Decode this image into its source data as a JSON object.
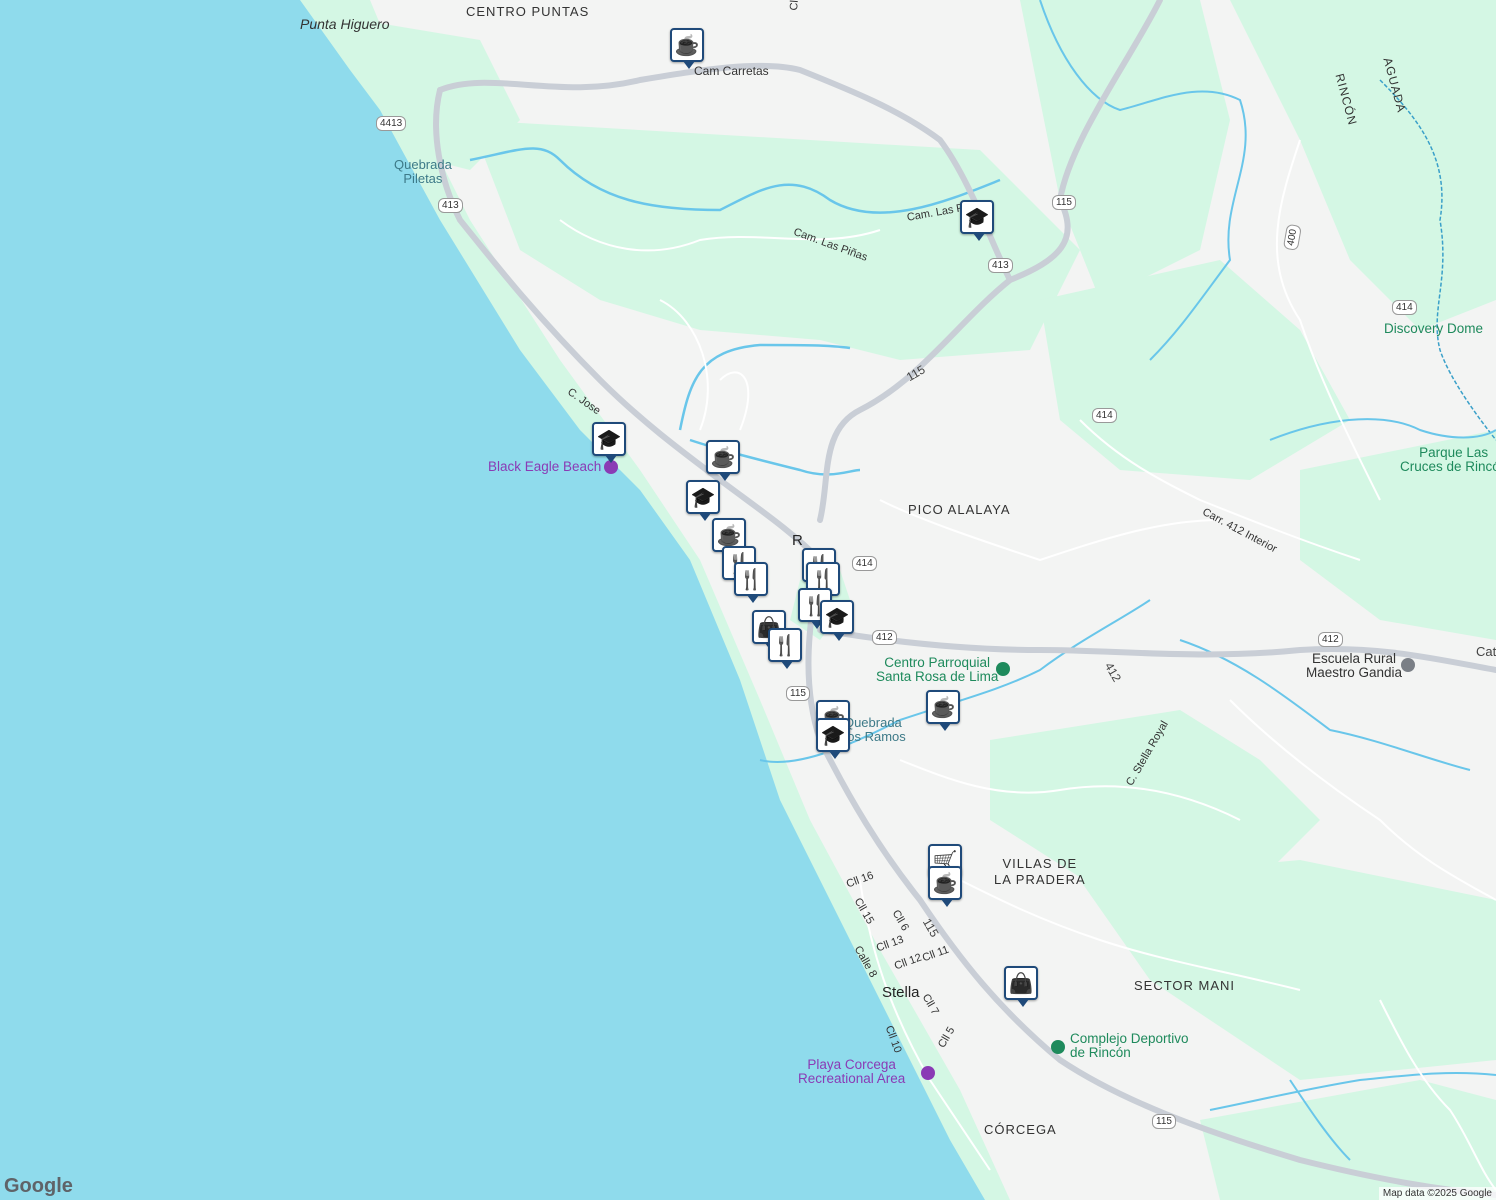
{
  "labels": {
    "punta_higuero": "Punta Higuero",
    "centro_puntas": "CENTRO PUNTAS",
    "cam_carretas": "Cam Carretas",
    "cll_mira": "Cll Mira",
    "quebrada_piletas": "Quebrada\nPiletas",
    "cam_las_pinas_1": "Cam. Las Piñas",
    "cam_las_pinas_2": "Cam. Las Piñas",
    "c_jose": "C. Jose",
    "black_eagle_beach": "Black Eagle Beach",
    "pico_alalaya": "PICO ALALAYA",
    "centro_parroquial": "Centro Parroquial\nSanta Rosa de Lima",
    "quebrada_ramos": "Quebrada\nLos Ramos",
    "villas_de_la_pradera": "VILLAS DE\nLA PRADERA",
    "stella": "Stella",
    "sector_mani": "SECTOR MANI",
    "complejo_deportivo": "Complejo Deportivo\nde Rincón",
    "playa_corcega": "Playa Corcega\nRecreational Area",
    "corcega": "CÓRCEGA",
    "discovery_dome": "Discovery Dome",
    "parque_las_cruces": "Parque Las\nCruces de Rincón",
    "escuela_rural": "Escuela Rural\nMaestro Gandia",
    "carr_412_interior": "Carr. 412 Interior",
    "c_stella_royal": "C. Stella Royal",
    "rincon": "RINCÓN",
    "aguada": "AGUADA",
    "cat": "Cat",
    "r_town": "R",
    "road_115_a": "115",
    "road_115_b": "115",
    "road_412": "412",
    "streets": [
      "Cll 16",
      "Cll 15",
      "Cll 6",
      "Cll 13",
      "Cll 12",
      "Cll 11",
      "Calle 8",
      "Cll 7",
      "Cll 10",
      "Cll 5"
    ]
  },
  "shields": [
    "4413",
    "413",
    "413",
    "115",
    "414",
    "414",
    "115",
    "412",
    "412",
    "400",
    "414",
    "115"
  ],
  "attribution": "Map data ©2025 Google",
  "logo": "Google",
  "colors": {
    "water": "#8fdbec",
    "land": "#f3f4f3",
    "green": "#d4f7e4",
    "road": "#c9ced6",
    "pin_border": "#1f4a7a",
    "river": "#69c6ea"
  },
  "markers": [
    {
      "type": "cafe-icon"
    },
    {
      "type": "school-icon"
    },
    {
      "type": "school-icon"
    },
    {
      "type": "cafe-icon"
    },
    {
      "type": "school-icon"
    },
    {
      "type": "cafe-icon"
    },
    {
      "type": "restaurant-icon"
    },
    {
      "type": "restaurant-icon"
    },
    {
      "type": "restaurant-icon"
    },
    {
      "type": "restaurant-icon"
    },
    {
      "type": "restaurant-icon"
    },
    {
      "type": "school-icon"
    },
    {
      "type": "shop-icon"
    },
    {
      "type": "restaurant-icon"
    },
    {
      "type": "cafe-icon"
    },
    {
      "type": "school-icon"
    },
    {
      "type": "cafe-icon"
    },
    {
      "type": "cart-icon"
    },
    {
      "type": "cafe-icon"
    },
    {
      "type": "shop-icon"
    }
  ]
}
